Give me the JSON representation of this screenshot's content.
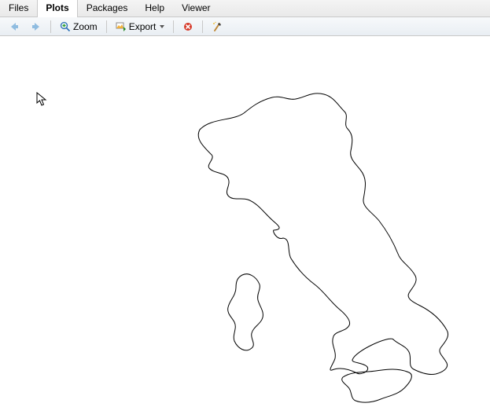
{
  "tabs": {
    "files": "Files",
    "plots": "Plots",
    "packages": "Packages",
    "help": "Help",
    "viewer": "Viewer",
    "active": "plots"
  },
  "toolbar": {
    "zoom_label": "Zoom",
    "export_label": "Export"
  },
  "colors": {
    "nav_arrow": "#8fbce0",
    "zoom_lens": "#2a6fb5",
    "zoom_plus": "#2aa12a",
    "export_paint": "#f3b23a",
    "export_arrow": "#2a8a2a",
    "remove_circle": "#d63a2a",
    "brush_handle": "#c08a3a",
    "brush_tip": "#444",
    "brush_sparkle": "#f0c040"
  }
}
